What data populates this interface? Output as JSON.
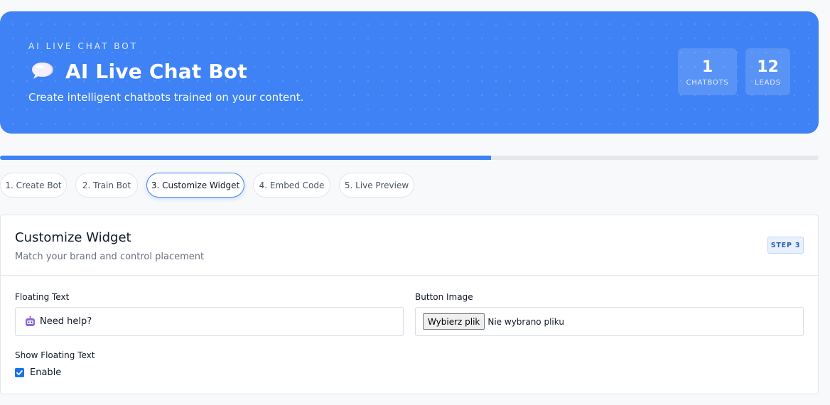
{
  "hero": {
    "kicker": "AI LIVE CHAT BOT",
    "title": "AI Live Chat Bot",
    "subtitle": "Create intelligent chatbots trained on your content.",
    "stats": [
      {
        "value": "1",
        "label": "CHATBOTS"
      },
      {
        "value": "12",
        "label": "LEADS"
      }
    ]
  },
  "progress": {
    "fraction": 0.6
  },
  "steps": [
    {
      "label": "1. Create Bot",
      "active": false
    },
    {
      "label": "2. Train Bot",
      "active": false
    },
    {
      "label": "3. Customize Widget",
      "active": true
    },
    {
      "label": "4. Embed Code",
      "active": false
    },
    {
      "label": "5. Live Preview",
      "active": false
    }
  ],
  "card": {
    "title": "Customize Widget",
    "subtitle": "Match your brand and control placement",
    "badge": "STEP 3",
    "floating_text": {
      "label": "Floating Text",
      "value": "Need help?"
    },
    "button_image": {
      "label": "Button Image",
      "button_label": "Wybierz plik",
      "status": "Nie wybrano pliku"
    },
    "show_floating": {
      "label": "Show Floating Text",
      "checkbox_label": "Enable",
      "checked": true
    }
  },
  "colors": {
    "accent": "#3e82f5",
    "checkbox": "#1a73e8"
  }
}
